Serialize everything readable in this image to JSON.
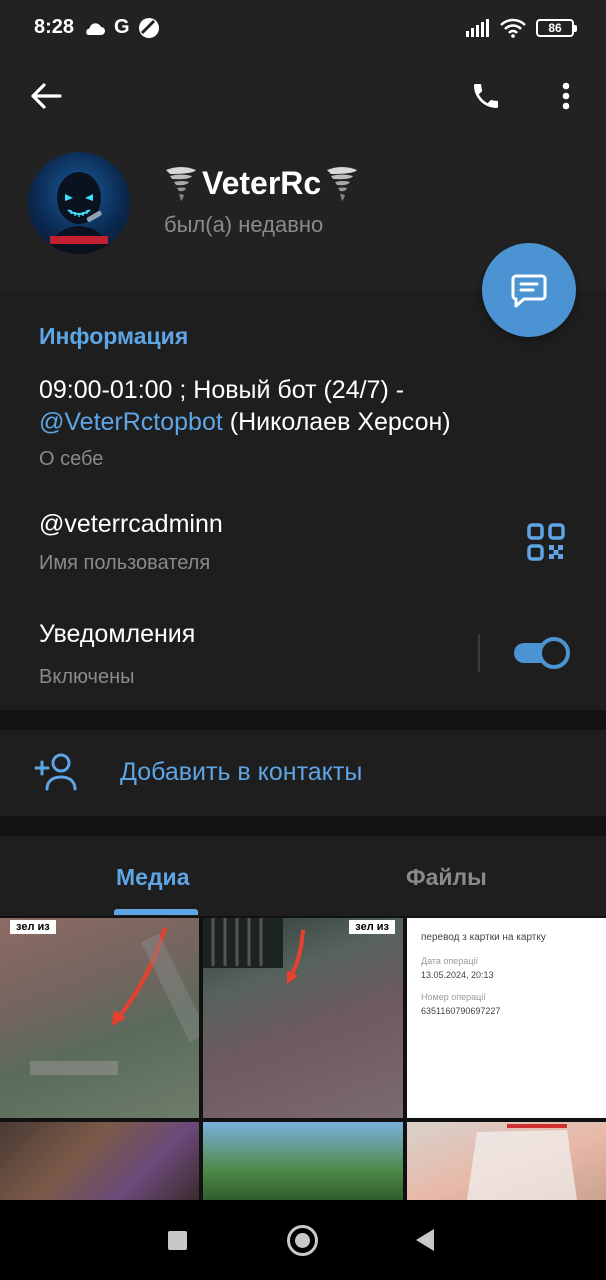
{
  "status_bar": {
    "time": "8:28",
    "g_label": "G",
    "battery": "86",
    "icons": [
      "cloud-icon",
      "g-icon",
      "dnd-icon",
      "signal-icon",
      "wifi-icon",
      "battery-icon"
    ]
  },
  "header": {
    "name": "VeterRc",
    "last_seen": "был(а) недавно",
    "icons": [
      "back-arrow-icon",
      "phone-icon",
      "more-vert-icon"
    ]
  },
  "fab": {
    "icon": "message-icon"
  },
  "info": {
    "title": "Информация",
    "bio_prefix": "09:00-01:00 ; Новый бот (24/7) -",
    "bio_link": "@VeterRctopbot",
    "bio_suffix": " (Николаев Херсон)",
    "bio_caption": "О себе",
    "username": "@veterrcadminn",
    "username_caption": "Имя пользователя",
    "notifications": "Уведомления",
    "notifications_state": "Включены",
    "notifications_enabled": true
  },
  "add_contact": {
    "label": "Добавить в контакты",
    "icon": "add-person-icon"
  },
  "tabs": [
    {
      "label": "Медиа",
      "active": true
    },
    {
      "label": "Файлы",
      "active": false
    }
  ],
  "media": {
    "badges": [
      "зел из",
      "зел из"
    ],
    "receipt_lines": [
      "перевод з картки на картку",
      "Дата операції",
      "13.05.2024, 20:13",
      "Номер операції",
      "6351160790697227"
    ]
  },
  "colors": {
    "accent": "#5ea5e6",
    "fab": "#4b93d2",
    "background": "#1e1e1e",
    "header": "#222222"
  }
}
